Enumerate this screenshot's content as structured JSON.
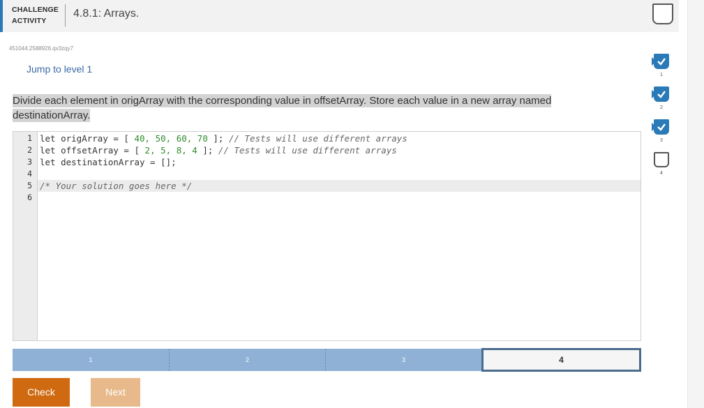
{
  "header": {
    "kind_line1": "CHALLENGE",
    "kind_line2": "ACTIVITY",
    "title": "4.8.1: Arrays."
  },
  "activity_code": "451044.2588926.qx3zqy7",
  "jump_link": "Jump to level 1",
  "prompt": "Divide each element in origArray with the corresponding value in offsetArray. Store each value in a new array named destinationArray.",
  "editor": {
    "line_numbers": [
      "1",
      "2",
      "3",
      "4",
      "5",
      "6"
    ],
    "lines": [
      {
        "kw": "let ",
        "name": "origArray",
        "rest": " = [ ",
        "nums": "40, 50, 60, 70",
        "end": " ]; ",
        "comment": "// Tests will use different arrays"
      },
      {
        "kw": "let ",
        "name": "offsetArray",
        "rest": " = [ ",
        "nums": "2, 5, 8, 4",
        "end": " ]; ",
        "comment": "// Tests will use different arrays"
      },
      {
        "kw": "let ",
        "name": "destinationArray",
        "rest": " = [];",
        "nums": "",
        "end": "",
        "comment": ""
      },
      {
        "kw": "",
        "name": "",
        "rest": "",
        "nums": "",
        "end": "",
        "comment": ""
      },
      {
        "kw": "",
        "name": "",
        "rest": "",
        "nums": "",
        "end": "",
        "comment": "/* Your solution goes here */"
      },
      {
        "kw": "",
        "name": "",
        "rest": "",
        "nums": "",
        "end": "",
        "comment": ""
      }
    ]
  },
  "progress": {
    "segments": [
      "1",
      "2",
      "3",
      "4"
    ],
    "current": "4"
  },
  "buttons": {
    "check": "Check",
    "next": "Next"
  },
  "levels": [
    {
      "label": "1",
      "status": "completed"
    },
    {
      "label": "2",
      "status": "completed"
    },
    {
      "label": "3",
      "status": "completed"
    },
    {
      "label": "4",
      "status": "incomplete"
    }
  ],
  "colors": {
    "accent": "#2a7ab8",
    "check_button": "#cf6a10",
    "next_button": "#e8b98a",
    "progress_done": "#8fb1d6"
  }
}
